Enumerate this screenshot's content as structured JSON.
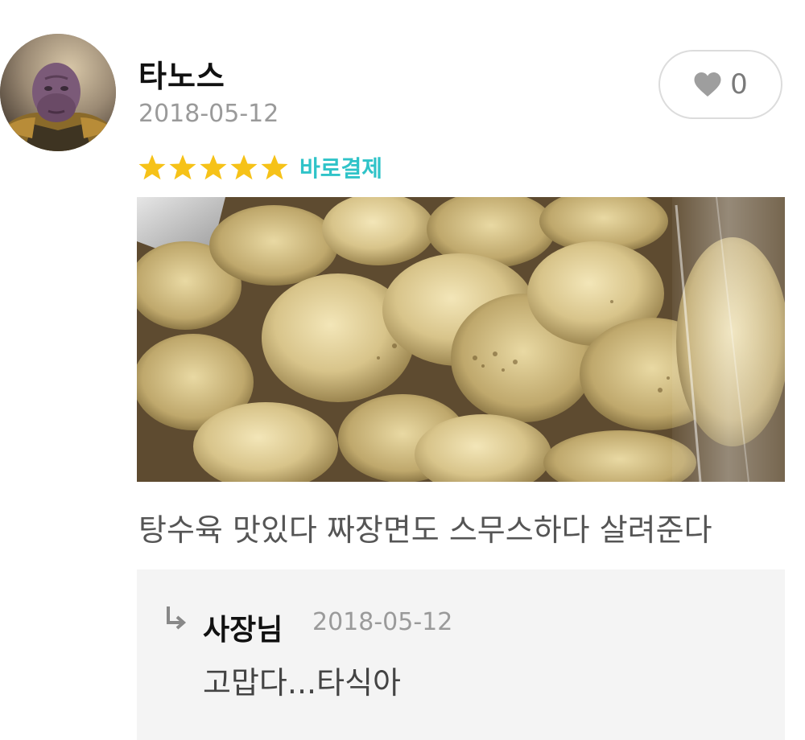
{
  "review": {
    "author": "타노스",
    "date": "2018-05-12",
    "rating": 5,
    "rating_max": 5,
    "payment_badge": "바로결제",
    "text": "탕수육 맛있다 짜장면도 스무스하다 살려준다",
    "photo_icon": "food-photo"
  },
  "like": {
    "icon": "heart-icon",
    "count": "0"
  },
  "reply": {
    "icon": "reply-arrow-icon",
    "author": "사장님",
    "date": "2018-05-12",
    "text": "고맙다...타식아"
  },
  "colors": {
    "star": "#f6c218",
    "badge": "#2fc3c8",
    "reply_bg": "#f4f4f4",
    "date": "#9a9a9a"
  }
}
